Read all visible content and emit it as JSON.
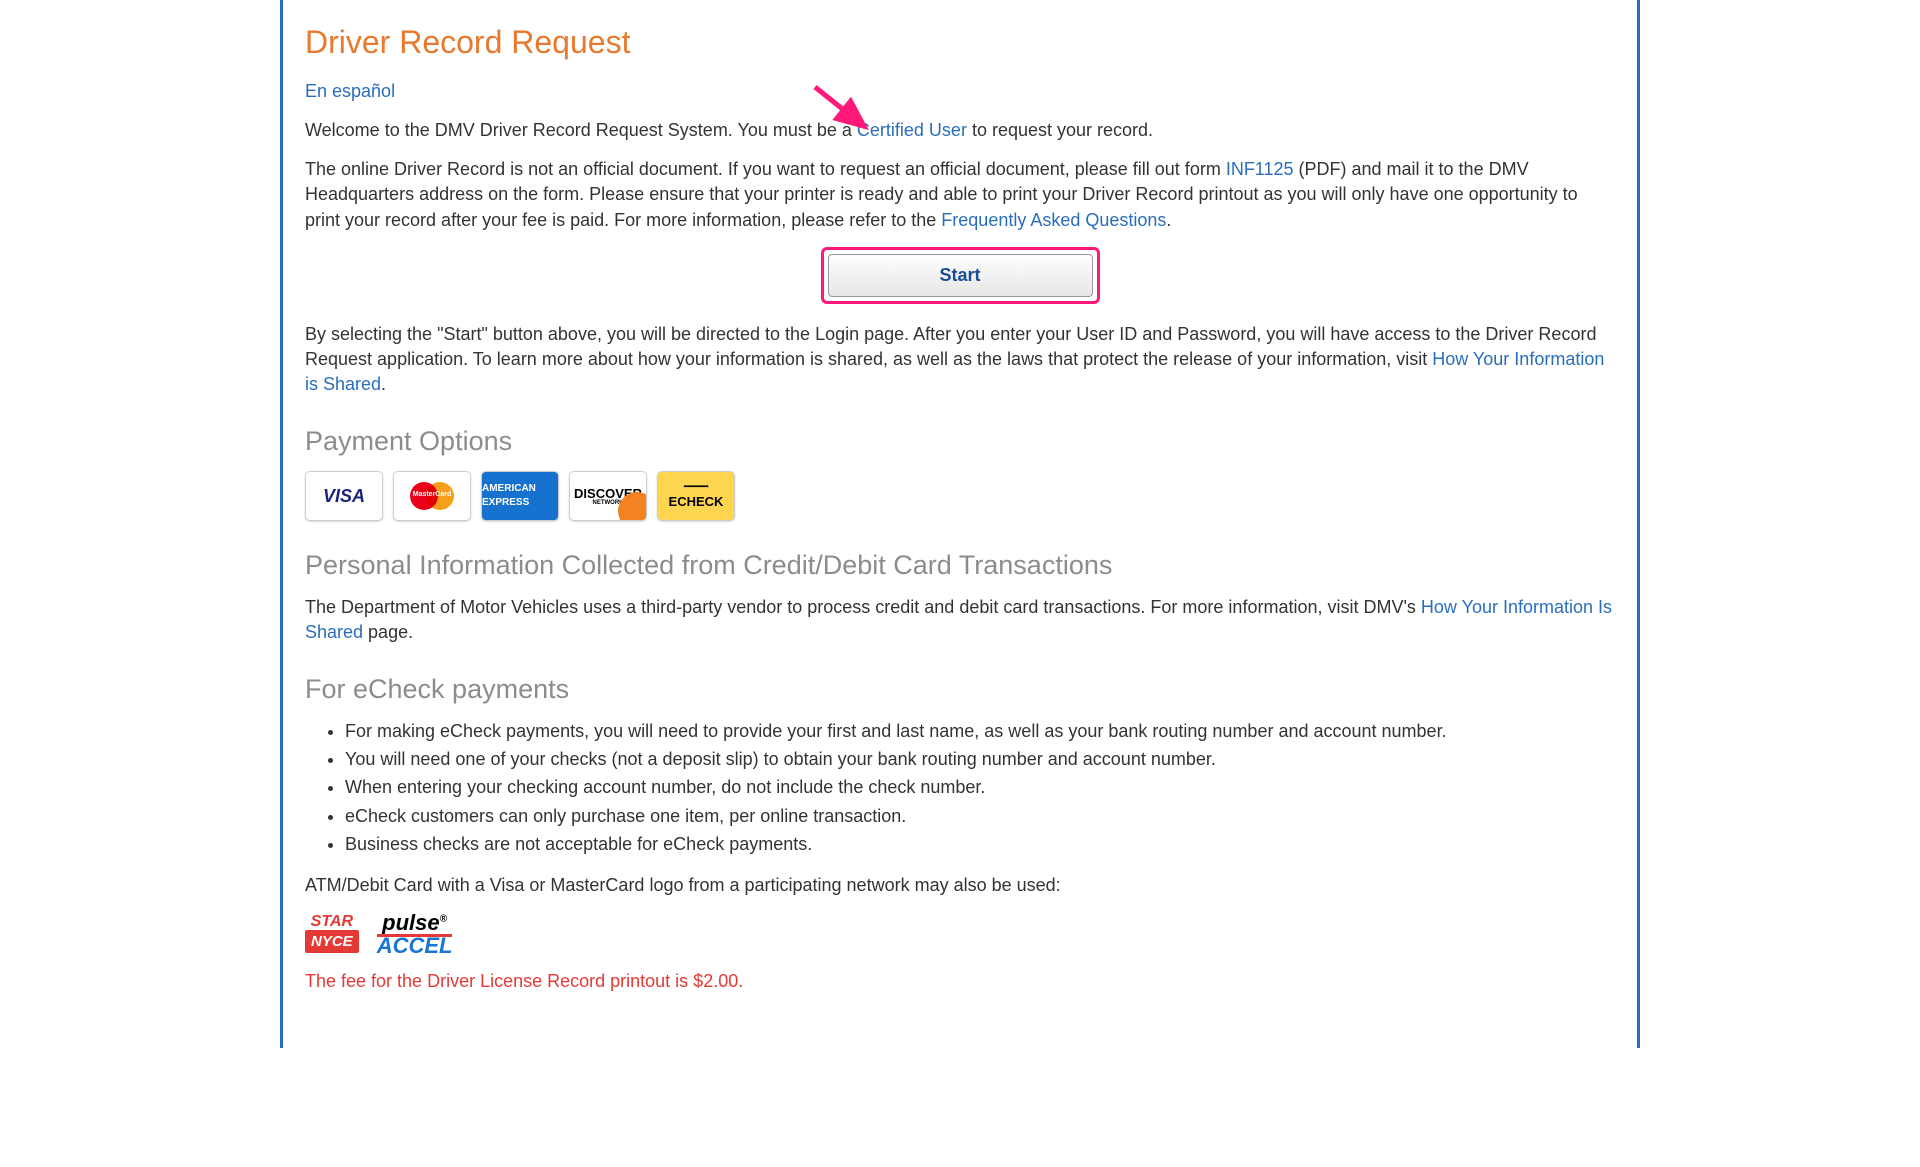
{
  "title": "Driver Record Request",
  "spanish_link": "En español",
  "intro1a": "Welcome to the DMV Driver Record Request System. You must be a ",
  "intro1_link": "Certified User",
  "intro1b": " to request your record.",
  "intro2a": "The online Driver Record is not an official document. If you want to request an official document, please fill out form ",
  "intro2_link1": "INF1125",
  "intro2b": " (PDF) and mail it to the DMV Headquarters address on the form. Please ensure that your printer is ready and able to print your Driver Record printout as you will only have one opportunity to print your record after your fee is paid. For more information, please refer to the ",
  "intro2_link2": "Frequently Asked Questions",
  "intro2c": ".",
  "start_label": "Start",
  "post1a": "By selecting the \"Start\" button above, you will be directed to the Login page. After you enter your User ID and Password, you will have access to the Driver Record Request application. To learn more about how your information is shared, as well as the laws that protect the release of your information, visit ",
  "post1_link": "How Your Information is Shared",
  "post1b": ".",
  "h_payment": "Payment Options",
  "cards": {
    "visa": "VISA",
    "mc": "MasterCard",
    "amex": "AMERICAN EXPRESS",
    "discover": "DISCOVER",
    "discover_sub": "NETWORK",
    "echeck": "ECHECK"
  },
  "h_personal": "Personal Information Collected from Credit/Debit Card Transactions",
  "personal_a": "The Department of Motor Vehicles uses a third-party vendor to process credit and debit card transactions. For more information, visit DMV's ",
  "personal_link": "How Your Information Is Shared",
  "personal_b": " page.",
  "h_echeck": "For eCheck payments",
  "echeck_items": [
    "For making eCheck payments, you will need to provide your first and last name, as well as your bank routing number and account number.",
    "You will need one of your checks (not a deposit slip) to obtain your bank routing number and account number.",
    "When entering your checking account number, do not include the check number.",
    "eCheck customers can only purchase one item, per online transaction.",
    "Business checks are not acceptable for eCheck payments."
  ],
  "atm_text": "ATM/Debit Card with a Visa or MasterCard logo from a participating network may also be used:",
  "nets": {
    "star": "STAR",
    "nyce": "NYCE",
    "pulse": "pulse",
    "accel": "ACCEL"
  },
  "fee_text": "The fee for the Driver License Record printout is $2.00."
}
